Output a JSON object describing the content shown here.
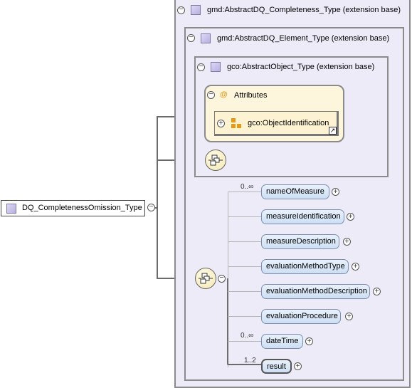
{
  "root": {
    "label": "DQ_CompletenessOmission_Type"
  },
  "outer_box": {
    "label": "gmd:AbstractDQ_Completeness_Type (extension base)"
  },
  "middle_box": {
    "label": "gmd:AbstractDQ_Element_Type (extension base)"
  },
  "inner_box": {
    "label": "gco:AbstractObject_Type (extension base)"
  },
  "attributes": {
    "label": "Attributes",
    "at_symbol": "@",
    "group": "gco:ObjectIdentification"
  },
  "elements": [
    {
      "label": "nameOfMeasure",
      "cardinality": "0..∞"
    },
    {
      "label": "measureIdentification",
      "cardinality": ""
    },
    {
      "label": "measureDescription",
      "cardinality": ""
    },
    {
      "label": "evaluationMethodType",
      "cardinality": ""
    },
    {
      "label": "evaluationMethodDescription",
      "cardinality": ""
    },
    {
      "label": "evaluationProcedure",
      "cardinality": ""
    },
    {
      "label": "dateTime",
      "cardinality": "0..∞"
    },
    {
      "label": "result",
      "cardinality": "1..2"
    }
  ],
  "symbols": {
    "collapse": "−",
    "expand": "+"
  },
  "colors": {
    "box_fill": "#ecebf7",
    "attr_fill": "#fdf6dd",
    "element_fill": "#dce8f8",
    "border": "#8b8b8b"
  }
}
